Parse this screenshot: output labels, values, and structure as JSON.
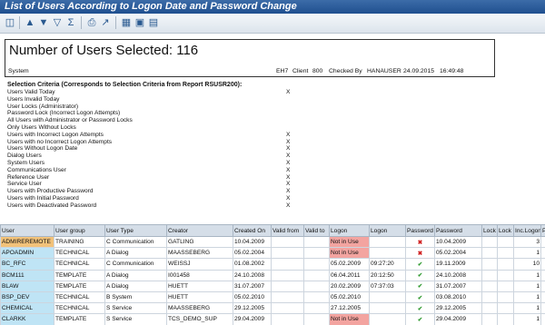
{
  "window": {
    "title": "List of Users According to Logon Date and Password Change"
  },
  "toolbar": {
    "icons": [
      "refresh-icon",
      "sort-asc-icon",
      "sort-desc-icon",
      "filter-icon",
      "sum-icon",
      "print-icon",
      "export-icon",
      "layout-icon",
      "grid-icon"
    ]
  },
  "header": {
    "title": "Number of Users Selected: 116",
    "system_label": "System",
    "system_value": "EH7",
    "client_label": "Client",
    "client_value": "800",
    "checked_by_label": "Checked By",
    "checked_by_value": "HANAUSER",
    "date": "24.09.2015",
    "time": "16:49:48"
  },
  "criteria": {
    "title": "Selection Criteria (Corresponds to Selection Criteria from Report RSUSR200):",
    "rows": [
      {
        "label": "Users Valid Today",
        "mark": "X"
      },
      {
        "label": "Users Invalid Today",
        "mark": ""
      },
      {
        "label": "User Locks (Administrator)",
        "mark": ""
      },
      {
        "label": "Password Lock (Incorrect Logon Attempts)",
        "mark": ""
      },
      {
        "label": "All Users with Administrator or Password Locks",
        "mark": ""
      },
      {
        "label": "Only Users Without Locks",
        "mark": ""
      },
      {
        "label": "Users with Incorrect Logon Attempts",
        "mark": "X"
      },
      {
        "label": "Users with no Incorrect Logon Attempts",
        "mark": "X"
      },
      {
        "label": "Users Without Logon Date",
        "mark": "X"
      },
      {
        "label": "Dialog Users",
        "mark": "X"
      },
      {
        "label": "System Users",
        "mark": "X"
      },
      {
        "label": "Communications User",
        "mark": "X"
      },
      {
        "label": "Reference User",
        "mark": "X"
      },
      {
        "label": "Service User",
        "mark": "X"
      },
      {
        "label": "Users with Productive Password",
        "mark": "X"
      },
      {
        "label": "Users with Initial Password",
        "mark": "X"
      },
      {
        "label": "Users with Deactivated Password",
        "mark": "X"
      }
    ]
  },
  "table": {
    "columns": [
      "User",
      "User group",
      "User Type",
      "Creator",
      "Created On",
      "Valid from",
      "Valid to",
      "Logon",
      "Logon",
      "Password",
      "Password",
      "Lock",
      "Lock",
      "Inc.Logons",
      "P"
    ],
    "rows": [
      [
        "ADMIREREMOTE",
        "TRAINING",
        "C Communication",
        "GATLING",
        "10.04.2009",
        "",
        "",
        "Not in Use",
        "",
        "x",
        "10.04.2009",
        "",
        "",
        "3",
        ""
      ],
      [
        "APOADMIN",
        "TECHNICAL",
        "A Dialog",
        "MAASSEBERG",
        "05.02.2004",
        "",
        "",
        "Not in Use",
        "",
        "x",
        "05.02.2004",
        "",
        "",
        "1",
        ""
      ],
      [
        "BC_RFC",
        "TECHNICAL",
        "C Communication",
        "WEISSJ",
        "01.08.2002",
        "",
        "",
        "05.02.2009",
        "09:27:20",
        "check",
        "19.11.2009",
        "",
        "",
        "10",
        ""
      ],
      [
        "BCM111",
        "TEMPLATE",
        "A Dialog",
        "I001458",
        "24.10.2008",
        "",
        "",
        "06.04.2011",
        "20:12:50",
        "check",
        "24.10.2008",
        "",
        "",
        "1",
        ""
      ],
      [
        "BLAW",
        "TEMPLATE",
        "A Dialog",
        "HUETT",
        "31.07.2007",
        "",
        "",
        "20.02.2009",
        "07:37:03",
        "check",
        "31.07.2007",
        "",
        "",
        "1",
        ""
      ],
      [
        "BSP_DEV",
        "TECHNICAL",
        "B System",
        "HUETT",
        "05.02.2010",
        "",
        "",
        "05.02.2010",
        "",
        "check",
        "03.08.2010",
        "",
        "",
        "1",
        ""
      ],
      [
        "CHEMICAL",
        "TECHNICAL",
        "S Service",
        "MAASSEBERG",
        "29.12.2005",
        "",
        "",
        "27.12.2005",
        "",
        "check",
        "29.12.2005",
        "",
        "",
        "1",
        ""
      ],
      [
        "CLARKK",
        "TEMPLATE",
        "S Service",
        "TCS_DEMO_SUP",
        "29.04.2009",
        "",
        "",
        "Not in Use",
        "",
        "check",
        "29.04.2009",
        "",
        "",
        "1",
        ""
      ],
      [
        "CMS_FRX",
        "TEMPLATE",
        "S Service",
        "MAASSEBERG",
        "",
        "",
        "",
        "22.06.2005",
        "06:42:50",
        "check",
        "01.08.2005",
        "",
        "",
        "1",
        ""
      ]
    ]
  }
}
